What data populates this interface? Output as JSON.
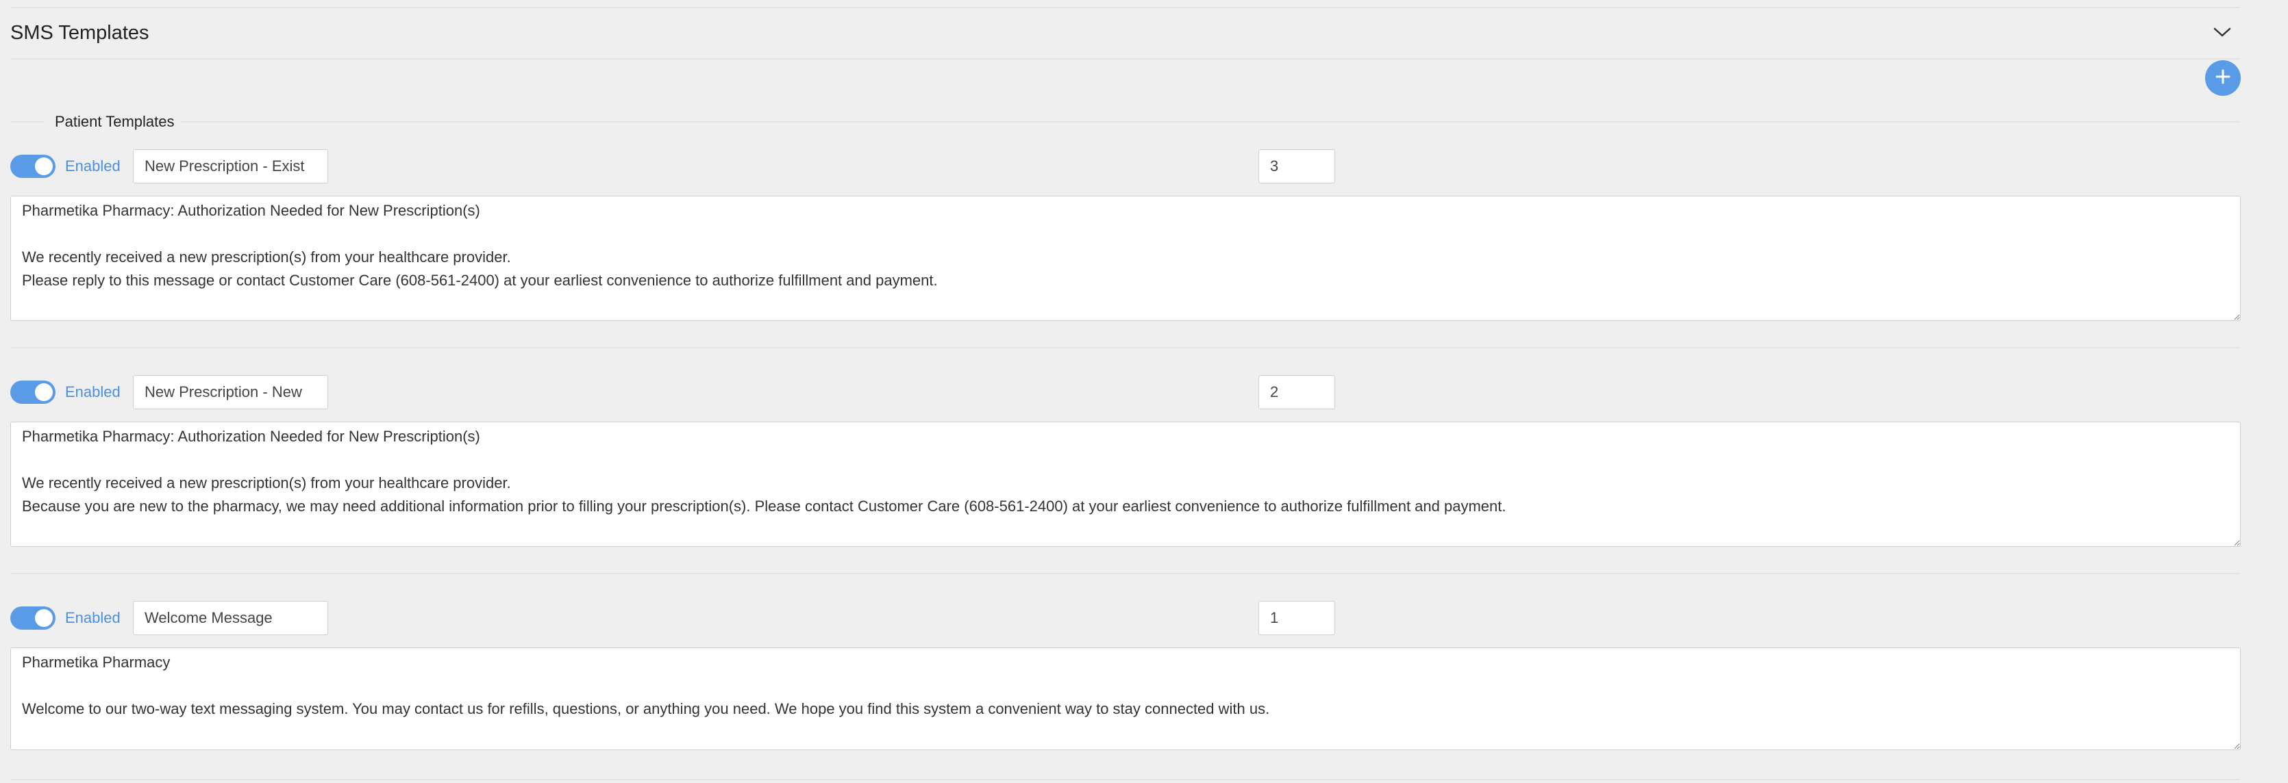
{
  "panel": {
    "title": "SMS Templates",
    "collapse_icon": "chevron-down-icon",
    "add_icon": "plus-icon"
  },
  "section": {
    "label": "Patient Templates"
  },
  "templates": [
    {
      "enabled": true,
      "enabled_label": "Enabled",
      "name": "New Prescription - Exist",
      "order": "3",
      "message": "Pharmetika Pharmacy: Authorization Needed for New Prescription(s)\n\nWe recently received a new prescription(s) from your healthcare provider.\nPlease reply to this message or contact Customer Care (608-561-2400) at your earliest convenience to authorize fulfillment and payment."
    },
    {
      "enabled": true,
      "enabled_label": "Enabled",
      "name": "New Prescription - New",
      "order": "2",
      "message": "Pharmetika Pharmacy: Authorization Needed for New Prescription(s)\n\nWe recently received a new prescription(s) from your healthcare provider.\nBecause you are new to the pharmacy, we may need additional information prior to filling your prescription(s). Please contact Customer Care (608-561-2400) at your earliest convenience to authorize fulfillment and payment."
    },
    {
      "enabled": true,
      "enabled_label": "Enabled",
      "name": "Welcome Message",
      "order": "1",
      "message": "Pharmetika Pharmacy\n\nWelcome to our two-way text messaging system. You may contact us for refills, questions, or anything you need. We hope you find this system a convenient way to stay connected with us."
    }
  ],
  "colors": {
    "accent": "#5a9be8",
    "enabled_text": "#4a90e2",
    "background": "#efefef"
  }
}
